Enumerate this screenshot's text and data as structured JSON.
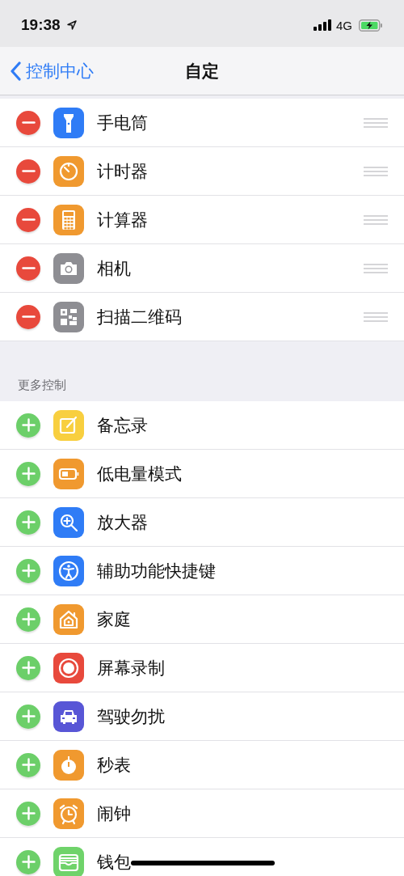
{
  "status_bar": {
    "time": "19:38",
    "network": "4G"
  },
  "nav": {
    "back": "控制中心",
    "title": "自定"
  },
  "included": [
    {
      "label": "手电筒",
      "kind": "flashlight"
    },
    {
      "label": "计时器",
      "kind": "timer"
    },
    {
      "label": "计算器",
      "kind": "calculator"
    },
    {
      "label": "相机",
      "kind": "camera"
    },
    {
      "label": "扫描二维码",
      "kind": "qr"
    }
  ],
  "more_section": {
    "header": "更多控制"
  },
  "more": [
    {
      "label": "备忘录",
      "kind": "notes"
    },
    {
      "label": "低电量模式",
      "kind": "battery"
    },
    {
      "label": "放大器",
      "kind": "magnifier"
    },
    {
      "label": "辅助功能快捷键",
      "kind": "accessibility"
    },
    {
      "label": "家庭",
      "kind": "home"
    },
    {
      "label": "屏幕录制",
      "kind": "record"
    },
    {
      "label": "驾驶勿扰",
      "kind": "car"
    },
    {
      "label": "秒表",
      "kind": "stopwatch"
    },
    {
      "label": "闹钟",
      "kind": "alarm"
    },
    {
      "label": "钱包",
      "kind": "wallet"
    }
  ]
}
